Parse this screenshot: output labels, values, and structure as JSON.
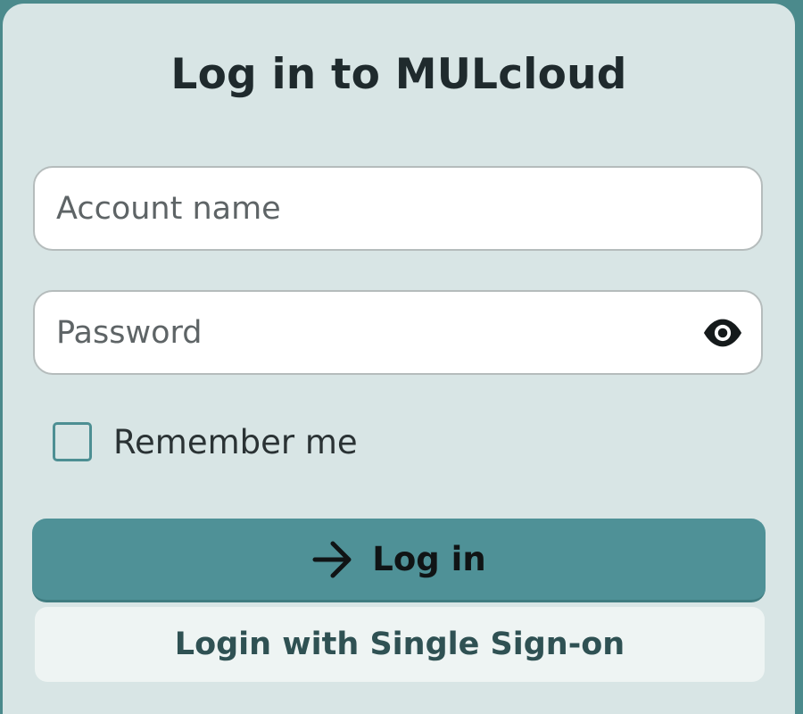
{
  "title": "Log in to MULcloud",
  "account": {
    "placeholder": "Account name",
    "value": ""
  },
  "password": {
    "placeholder": "Password",
    "value": "",
    "toggle_icon": "eye-icon"
  },
  "remember": {
    "label": "Remember me",
    "checked": false
  },
  "login_button": {
    "label": "Log in",
    "icon": "arrow-right-icon"
  },
  "sso_button": {
    "label": "Login with Single Sign-on"
  },
  "colors": {
    "backdrop": "#4b8a8c",
    "panel": "#d8e5e5",
    "primary": "#4f9197",
    "secondary_button": "#eef4f3",
    "secondary_text": "#2f5153"
  }
}
